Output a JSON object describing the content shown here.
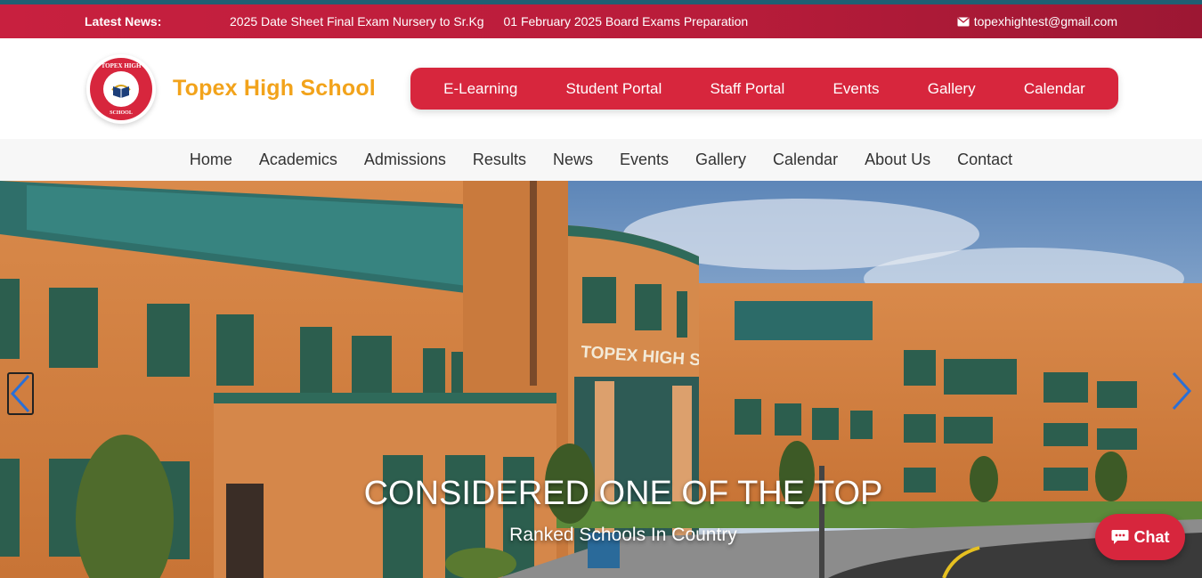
{
  "news": {
    "label": "Latest News:",
    "items": [
      "2025 Date Sheet Final Exam Nursery to Sr.Kg",
      "01 February 2025 Board Exams Preparation"
    ],
    "email": "topexhightest@gmail.com"
  },
  "header": {
    "logo_top": "TOPEX HIGH",
    "logo_bottom": "SCHOOL",
    "title": "Topex High School",
    "portal_links": [
      "E-Learning",
      "Student Portal",
      "Staff Portal",
      "Events",
      "Gallery",
      "Calendar"
    ]
  },
  "nav": {
    "items": [
      "Home",
      "Academics",
      "Admissions",
      "Results",
      "News",
      "Events",
      "Gallery",
      "Calendar",
      "About Us",
      "Contact"
    ]
  },
  "hero": {
    "building_sign": "TOPEX HIGH SCHOOL",
    "title": "CONSIDERED ONE OF THE TOP",
    "subtitle": "Ranked Schools In Country"
  },
  "chat": {
    "label": "Chat"
  },
  "colors": {
    "brand_red": "#d7263d",
    "title_orange": "#f2a31b",
    "topline": "#1f5f73"
  },
  "icons": {
    "email": "envelope-icon",
    "chat": "chat-bubble-icon",
    "prev": "chevron-left-icon",
    "next": "chevron-right-icon"
  }
}
